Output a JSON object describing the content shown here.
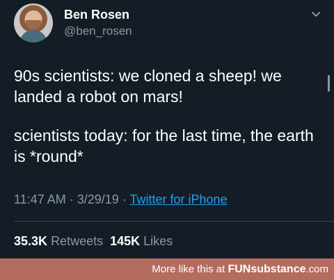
{
  "tweet": {
    "display_name": "Ben Rosen",
    "handle": "@ben_rosen",
    "paragraph_1": "90s scientists: we cloned a sheep! we landed a robot on mars!",
    "paragraph_2": "scientists today: for the last time, the earth is *round*",
    "time": "11:47 AM",
    "separator": "·",
    "date": "3/29/19",
    "source": "Twitter for iPhone",
    "retweets_count": "35.3K",
    "retweets_label": "Retweets",
    "likes_count": "145K",
    "likes_label": "Likes"
  },
  "footer": {
    "prefix": "More like this at",
    "brand_bold": "FUN",
    "brand_rest": "substance",
    "brand_suffix": ".com"
  },
  "icons": {
    "chevron": "chevron-down-icon",
    "avatar": "profile-photo"
  },
  "colors": {
    "background": "#141d26",
    "primary_text": "#ffffff",
    "secondary_text": "#8899a6",
    "link": "#1da1f2",
    "footer_bg": "#b46c5f"
  }
}
